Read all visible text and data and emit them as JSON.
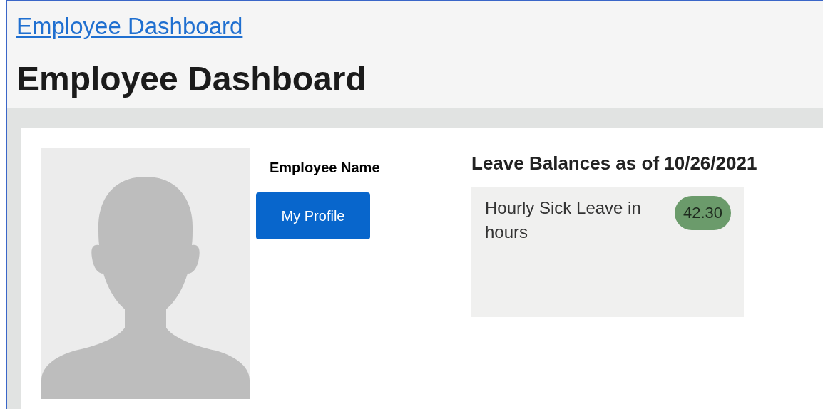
{
  "breadcrumb": {
    "label": "Employee Dashboard"
  },
  "heading": "Employee Dashboard",
  "profile": {
    "name_label": "Employee Name",
    "button": "My Profile"
  },
  "leave": {
    "title": "Leave Balances as of 10/26/2021",
    "items": [
      {
        "label": "Hourly Sick Leave in hours",
        "value": "42.30"
      }
    ]
  }
}
